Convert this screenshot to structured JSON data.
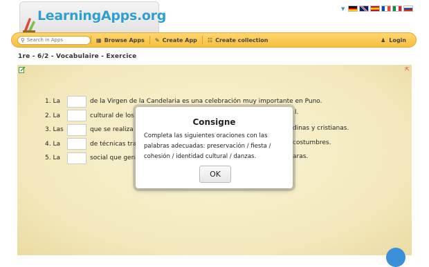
{
  "header": {
    "logo_text": "LearningApps.org",
    "flags": [
      "german-flag",
      "uk-flag",
      "spanish-flag",
      "french-flag",
      "italian-flag",
      "russian-flag"
    ]
  },
  "navbar": {
    "search_placeholder": "Search in Apps",
    "browse": "Browse Apps",
    "create_app": "Create App",
    "create_collection": "Create collection",
    "login": "Login"
  },
  "breadcrumb": "1re - 6/2 - Vocabulaire - Exercice",
  "exercise": {
    "lines": [
      {
        "num": "1. La",
        "text": "de la Virgen de la Candelaria es una celebración muy importante en Puno."
      },
      {
        "num": "2. La",
        "text": "cultural de los l"
      },
      {
        "num": "3. Las",
        "text": "que se realiza"
      },
      {
        "num": "4. La",
        "text": "de técnicas trad"
      },
      {
        "num": "5. La",
        "text": "social que gene"
      }
    ],
    "right_fragments": [
      "l.",
      "dinas y cristianas.",
      "costumbres.",
      "aras."
    ]
  },
  "modal": {
    "title": "Consigne",
    "body": "Completa las siguientes oraciones con las palabras adecuadas: preservación / fiesta / cohesión / identidad cultural / danzas.",
    "ok_label": "OK"
  },
  "colors": {
    "nav_yellow": "#f6be3e",
    "logo_blue": "#2f9fd1",
    "stage_bg": "#f5ecc6",
    "fab_blue": "#3a8fd8"
  }
}
